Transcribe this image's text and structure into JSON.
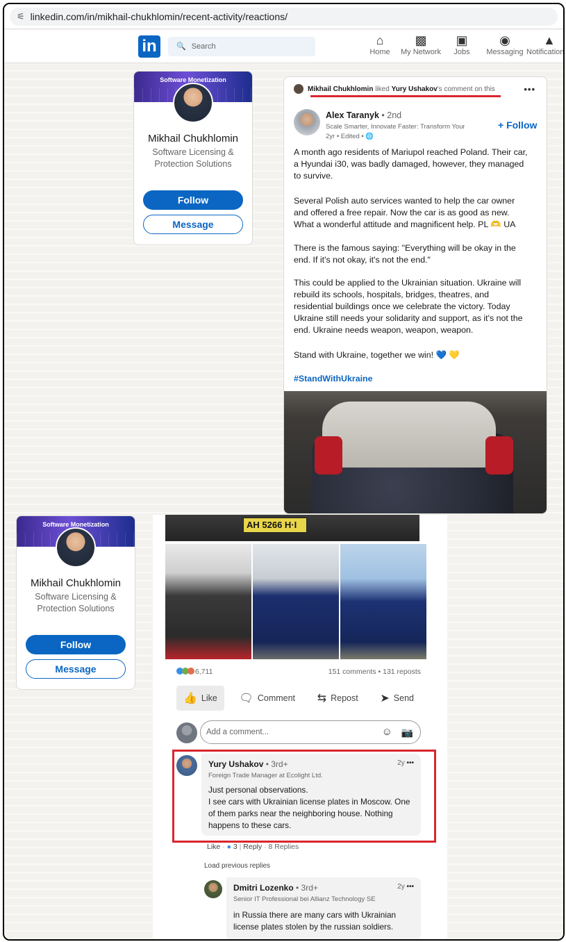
{
  "browser": {
    "url": "linkedin.com/in/mikhail-chukhlomin/recent-activity/reactions/"
  },
  "nav": {
    "logo": "in",
    "search_placeholder": "Search",
    "items": [
      {
        "label": "Home",
        "icon": "home-icon"
      },
      {
        "label": "My Network",
        "icon": "network-icon"
      },
      {
        "label": "Jobs",
        "icon": "jobs-icon"
      },
      {
        "label": "Messaging",
        "icon": "messaging-icon"
      },
      {
        "label": "Notifications",
        "icon": "notifications-icon"
      }
    ]
  },
  "profile": {
    "cover_text": "Software Monetization",
    "name": "Mikhail Chukhlomin",
    "headline": "Software Licensing & Protection Solutions",
    "follow": "Follow",
    "message": "Message"
  },
  "activity": {
    "actor": "Mikhail Chukhlomin",
    "verb": "liked",
    "target": "Yury Ushakov",
    "suffix": "'s comment on this"
  },
  "post": {
    "author": "Alex Taranyk",
    "degree": "• 2nd",
    "headline": "Scale Smarter, Innovate Faster: Transform Your Visi...",
    "time": "2yr • Edited •",
    "follow": "+ Follow",
    "paragraphs": [
      "A month ago residents of Mariupol reached Poland. Their car, a Hyundai i30, was badly damaged, however, they managed to survive.",
      "Several Polish auto services wanted to help the car owner and offered a free repair. Now the car is as good as new. What a wonderful attitude and magnificent help. PL 🫶 UA",
      "There is the famous saying: \"Everything will be okay in the end. If it's not okay, it's not the end.\"",
      "This could be applied to the Ukrainian situation. Ukraine will rebuild its schools, hospitals, bridges, theatres, and residential buildings once we celebrate the victory. Today Ukraine still needs your solidarity and support, as it's not the end. Ukraine needs weapon, weapon, weapon.",
      "Stand with Ukraine, together we win! 💙 💛"
    ],
    "hashtag": "#StandWithUkraine",
    "plate": "AH 5266 H·I",
    "reactions_count": "6,711",
    "comments_reposts": "151 comments • 131 reposts",
    "actions": [
      "Like",
      "Comment",
      "Repost",
      "Send"
    ],
    "comment_placeholder": "Add a comment..."
  },
  "comments": [
    {
      "name": "Yury Ushakov",
      "degree": "• 3rd+",
      "headline": "Foreign Trade Manager at Ecolight Ltd.",
      "time": "2y",
      "lines": [
        "Just personal observations.",
        "I see cars with Ukrainian license plates in Moscow. One",
        "of them parks near the neighboring house. Nothing",
        "happens to these cars."
      ],
      "like": "Like",
      "likes_count": "3",
      "reply": "Reply",
      "replies": "8 Replies"
    }
  ],
  "load_previous": "Load previous replies",
  "reply": {
    "name": "Dmitri Lozenko",
    "degree": "• 3rd+",
    "headline": "Senior IT Professional bei Allianz Technology SE",
    "time": "2y",
    "lines": [
      "in Russia there are many cars with Ukrainian",
      "license plates stolen by the russian soldiers."
    ]
  }
}
